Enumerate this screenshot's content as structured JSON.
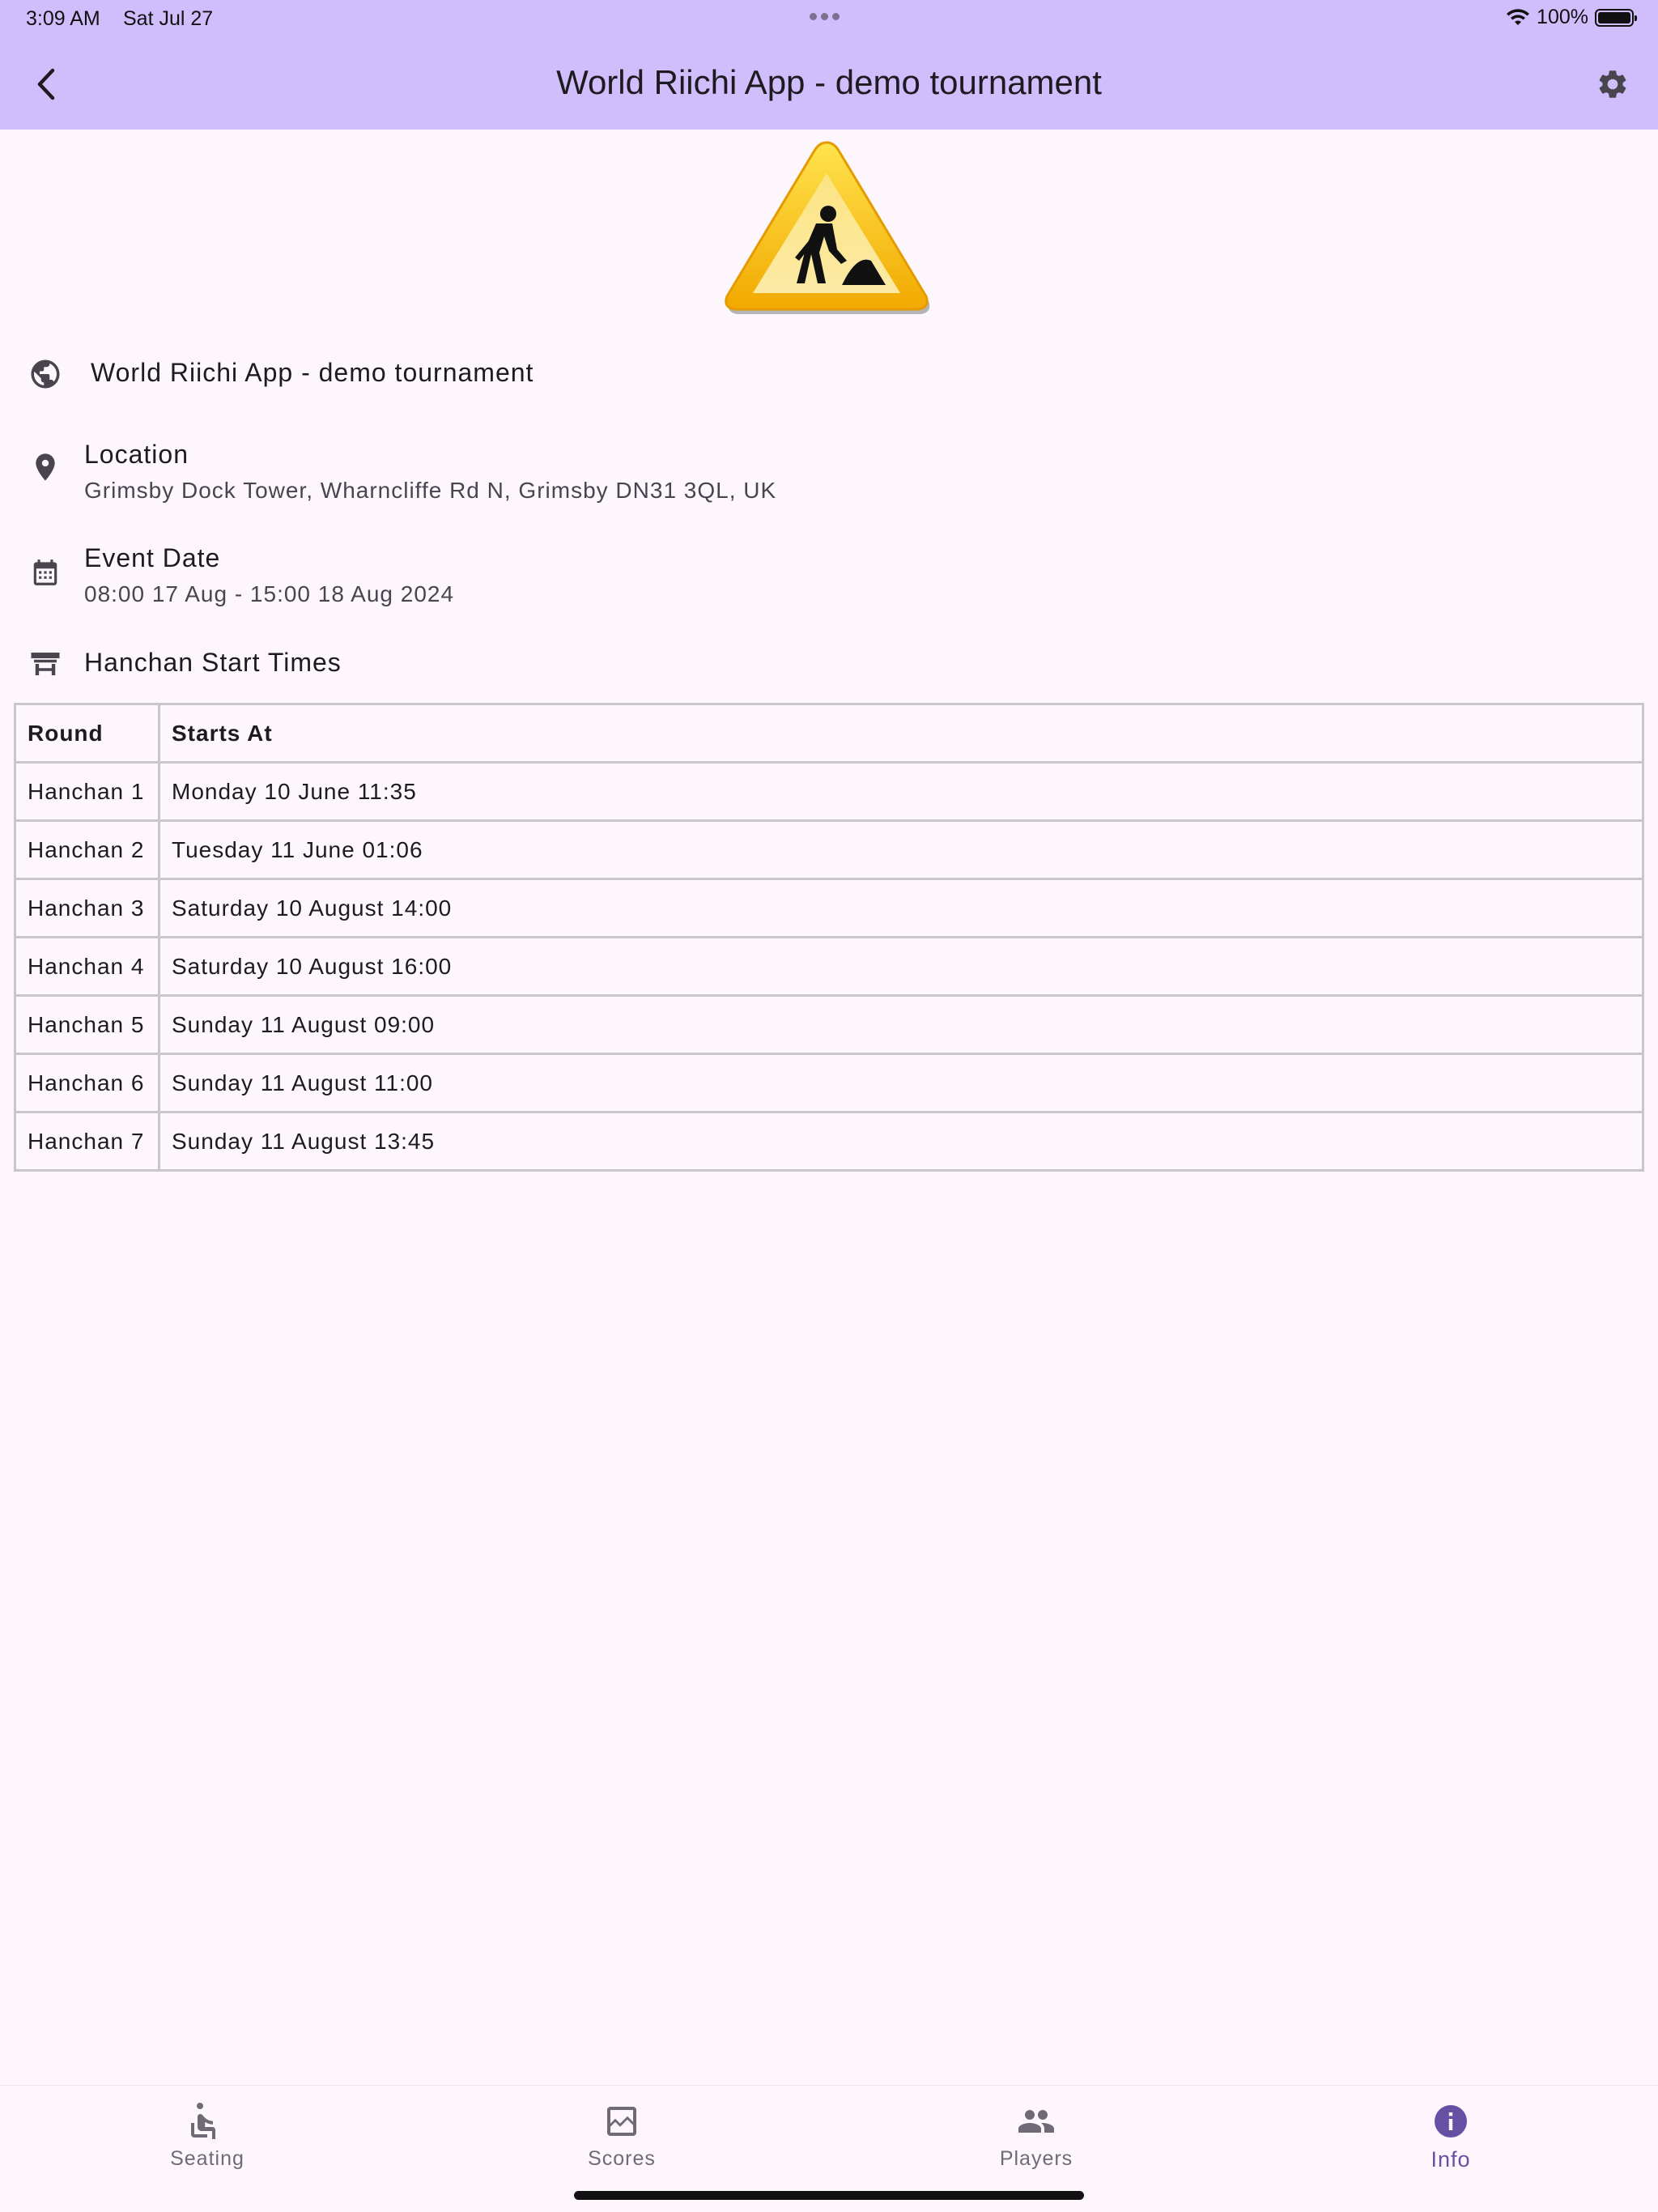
{
  "status_bar": {
    "time": "3:09 AM",
    "date": "Sat Jul 27",
    "battery": "100%"
  },
  "app_bar": {
    "title": "World Riichi App - demo tournament",
    "back_icon": "chevron-left-icon",
    "settings_icon": "gear-icon"
  },
  "info": {
    "name": "World Riichi App - demo tournament",
    "location_label": "Location",
    "location_value": "Grimsby Dock Tower, Wharncliffe Rd N, Grimsby DN31 3QL, UK",
    "date_label": "Event Date",
    "date_value": "08:00 17 Aug - 15:00 18 Aug 2024",
    "start_times_label": "Hanchan Start Times"
  },
  "schedule": {
    "headers": [
      "Round",
      "Starts At"
    ],
    "rows": [
      [
        "Hanchan 1",
        "Monday 10 June 11:35"
      ],
      [
        "Hanchan 2",
        "Tuesday 11 June 01:06"
      ],
      [
        "Hanchan 3",
        "Saturday 10 August 14:00"
      ],
      [
        "Hanchan 4",
        "Saturday 10 August 16:00"
      ],
      [
        "Hanchan 5",
        "Sunday 11 August 09:00"
      ],
      [
        "Hanchan 6",
        "Sunday 11 August 11:00"
      ],
      [
        "Hanchan 7",
        "Sunday 11 August 13:45"
      ]
    ]
  },
  "nav": {
    "items": [
      {
        "label": "Seating",
        "icon": "seat-icon"
      },
      {
        "label": "Scores",
        "icon": "chart-icon"
      },
      {
        "label": "Players",
        "icon": "people-icon"
      },
      {
        "label": "Info",
        "icon": "info-icon"
      }
    ],
    "active": "Info"
  },
  "colors": {
    "app_bar": "#cfbdfc",
    "background": "#fdf7fd",
    "accent": "#6650a4"
  }
}
